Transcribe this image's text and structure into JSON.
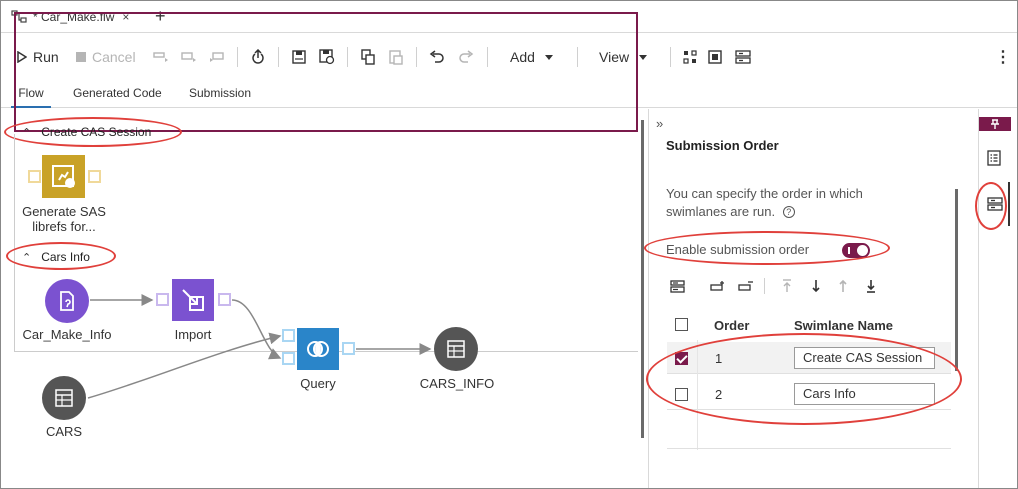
{
  "tab": {
    "title": "* Car_Make.flw",
    "close": "×",
    "add": "+"
  },
  "toolbar": {
    "run_label": "Run",
    "cancel_label": "Cancel",
    "add_label": "Add",
    "view_label": "View",
    "more": "⋮"
  },
  "view_tabs": [
    "Flow",
    "Generated Code",
    "Submission"
  ],
  "lanes": [
    {
      "title": "Create CAS Session",
      "nodes": [
        {
          "label_line1": "Generate SAS",
          "label_line2": "librefs for..."
        }
      ]
    },
    {
      "title": "Cars Info",
      "nodes": [
        {
          "label": "Car_Make_Info"
        },
        {
          "label": "Import"
        },
        {
          "label": "Query"
        },
        {
          "label": "CARS_INFO"
        },
        {
          "label": "CARS"
        }
      ]
    }
  ],
  "panel": {
    "collapse": "»",
    "title": "Submission Order",
    "description": "You can specify the order in which swimlanes are run.",
    "help": "?",
    "toggle_label": "Enable submission order",
    "toggle_on": true,
    "columns": {
      "order": "Order",
      "name": "Swimlane Name"
    },
    "rows": [
      {
        "order": "1",
        "name": "Create CAS Session",
        "checked": true
      },
      {
        "order": "2",
        "name": "Cars Info",
        "checked": false
      }
    ]
  },
  "colors": {
    "accent": "#7a1a4b",
    "highlight": "#e0403b",
    "sas_yellow": "#c9a227",
    "import_purple": "#7b52d0",
    "query_blue": "#2a85c9",
    "table_gray": "#555555"
  }
}
